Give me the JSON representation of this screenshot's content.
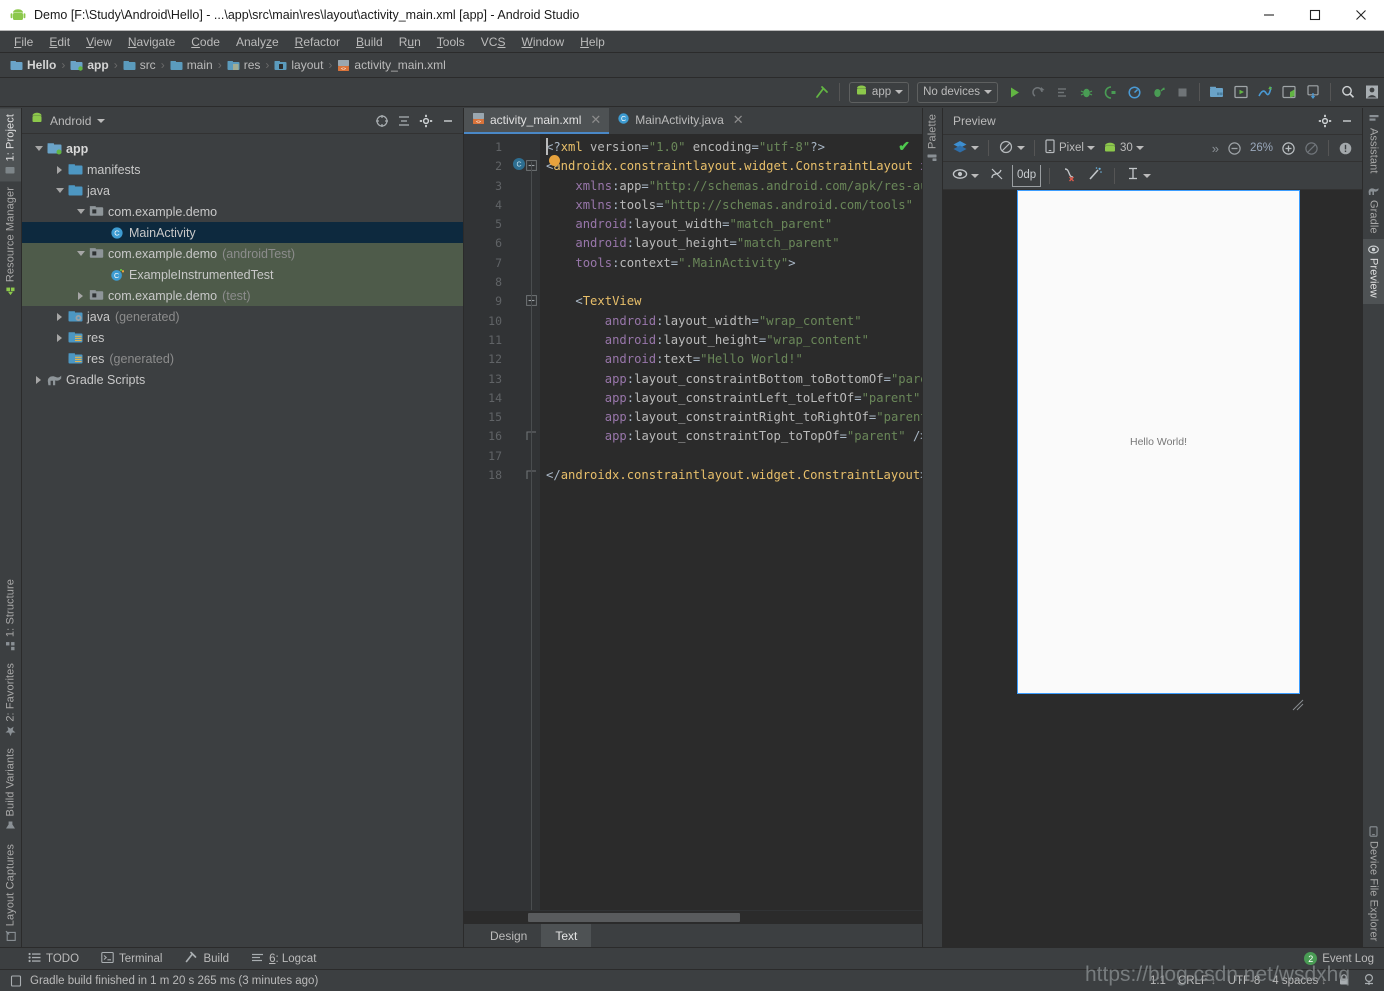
{
  "window": {
    "title": "Demo [F:\\Study\\Android\\Hello] - ...\\app\\src\\main\\res\\layout\\activity_main.xml [app] - Android Studio",
    "icon": "android-logo-icon",
    "minimize_label": "—",
    "maximize_label": "□",
    "close_label": "✕"
  },
  "menubar": {
    "items": [
      {
        "label": "File",
        "mnemonic": "F"
      },
      {
        "label": "Edit",
        "mnemonic": "E"
      },
      {
        "label": "View",
        "mnemonic": "V"
      },
      {
        "label": "Navigate",
        "mnemonic": "N"
      },
      {
        "label": "Code",
        "mnemonic": "C"
      },
      {
        "label": "Analyze",
        "mnemonic": "z"
      },
      {
        "label": "Refactor",
        "mnemonic": "R"
      },
      {
        "label": "Build",
        "mnemonic": "B"
      },
      {
        "label": "Run",
        "mnemonic": "u"
      },
      {
        "label": "Tools",
        "mnemonic": "T"
      },
      {
        "label": "VCS",
        "mnemonic": "S"
      },
      {
        "label": "Window",
        "mnemonic": "W"
      },
      {
        "label": "Help",
        "mnemonic": "H"
      }
    ]
  },
  "breadcrumb": {
    "items": [
      {
        "label": "Hello",
        "icon": "module-icon",
        "bold": true
      },
      {
        "label": "app",
        "icon": "module-app-icon",
        "bold": true
      },
      {
        "label": "src",
        "icon": "folder-icon",
        "bold": false
      },
      {
        "label": "main",
        "icon": "folder-icon",
        "bold": false
      },
      {
        "label": "res",
        "icon": "res-folder-icon",
        "bold": false
      },
      {
        "label": "layout",
        "icon": "layout-folder-icon",
        "bold": false
      },
      {
        "label": "activity_main.xml",
        "icon": "xml-layout-file-icon",
        "bold": false
      }
    ],
    "separator": "›"
  },
  "toolbar": {
    "build_hammer": "build-hammer-icon",
    "run_config": {
      "label": "app",
      "icon": "android-run-config-icon"
    },
    "device_selector": {
      "label": "No devices"
    },
    "buttons": [
      {
        "name": "run-button",
        "icon": "run-play-icon"
      },
      {
        "name": "apply-changes-button",
        "icon": "apply-changes-icon"
      },
      {
        "name": "apply-code-changes-button",
        "icon": "apply-code-changes-icon"
      },
      {
        "name": "debug-button",
        "icon": "debug-bug-icon"
      },
      {
        "name": "attach-debugger-button",
        "icon": "attach-debugger-icon"
      },
      {
        "name": "profiler-button",
        "icon": "profiler-icon"
      },
      {
        "name": "run-with-coverage-button",
        "icon": "run-coverage-icon"
      },
      {
        "name": "stop-button",
        "icon": "stop-square-icon"
      },
      {
        "name": "sdk-manager-button",
        "icon": "sdk-manager-icon"
      },
      {
        "name": "avd-manager-button",
        "icon": "avd-manager-icon"
      },
      {
        "name": "sync-gradle-button",
        "icon": "sync-gradle-icon"
      },
      {
        "name": "layout-inspector-button",
        "icon": "layout-inspector-icon"
      },
      {
        "name": "device-file-explorer-button",
        "icon": "device-download-icon"
      },
      {
        "name": "search-everywhere-button",
        "icon": "search-icon"
      },
      {
        "name": "user-account-button",
        "icon": "user-avatar-icon"
      }
    ]
  },
  "left_strip": {
    "top": [
      {
        "label": "1: Project",
        "mnemonic": "1",
        "icon": "project-icon",
        "active": true
      },
      {
        "label": "Resource Manager",
        "mnemonic": "",
        "icon": "resource-manager-icon",
        "active": false
      }
    ],
    "bottom": [
      {
        "label": "1: Structure",
        "mnemonic": "1",
        "icon": "structure-icon",
        "active": false
      },
      {
        "label": "2: Favorites",
        "mnemonic": "2",
        "icon": "favorites-star-icon",
        "active": false
      },
      {
        "label": "Build Variants",
        "mnemonic": "",
        "icon": "build-variants-icon",
        "active": false
      },
      {
        "label": "Layout Captures",
        "mnemonic": "",
        "icon": "layout-captures-icon",
        "active": false
      }
    ]
  },
  "right_strip": {
    "top": [
      {
        "label": "Assistant",
        "icon": "assistant-icon",
        "active": false
      },
      {
        "label": "Gradle",
        "icon": "gradle-elephant-icon",
        "active": false
      },
      {
        "label": "Preview",
        "icon": "preview-eye-icon",
        "active": true
      }
    ],
    "bottom": [
      {
        "label": "Device File Explorer",
        "icon": "device-file-explorer-icon",
        "active": false
      }
    ]
  },
  "editor_left_strip": {
    "items": [
      {
        "label": "Palette",
        "icon": "palette-icon",
        "active": false
      }
    ]
  },
  "project_panel": {
    "selector_label": "Android",
    "header_buttons": [
      {
        "name": "target-scope-button",
        "icon": "target-crosshair-icon"
      },
      {
        "name": "collapse-all-button",
        "icon": "collapse-all-icon"
      },
      {
        "name": "settings-gear-button",
        "icon": "gear-icon"
      },
      {
        "name": "hide-panel-button",
        "icon": "minus-icon"
      }
    ],
    "tree": [
      {
        "label": "app",
        "suffix": "",
        "indent": 0,
        "twisty": "down",
        "icon": "module-app-icon",
        "bold": true,
        "state": "normal"
      },
      {
        "label": "manifests",
        "suffix": "",
        "indent": 1,
        "twisty": "right",
        "icon": "folder-icon",
        "bold": false,
        "state": "normal"
      },
      {
        "label": "java",
        "suffix": "",
        "indent": 1,
        "twisty": "down",
        "icon": "folder-icon",
        "bold": false,
        "state": "normal"
      },
      {
        "label": "com.example.demo",
        "suffix": "",
        "indent": 2,
        "twisty": "down",
        "icon": "package-icon",
        "bold": false,
        "state": "normal"
      },
      {
        "label": "MainActivity",
        "suffix": "",
        "indent": 3,
        "twisty": "none",
        "icon": "java-class-icon",
        "bold": false,
        "state": "selected"
      },
      {
        "label": "com.example.demo",
        "suffix": "(androidTest)",
        "indent": 2,
        "twisty": "down",
        "icon": "package-icon",
        "bold": false,
        "state": "testgroup"
      },
      {
        "label": "ExampleInstrumentedTest",
        "suffix": "",
        "indent": 3,
        "twisty": "none",
        "icon": "java-test-class-icon",
        "bold": false,
        "state": "testgroup"
      },
      {
        "label": "com.example.demo",
        "suffix": "(test)",
        "indent": 2,
        "twisty": "right",
        "icon": "package-icon",
        "bold": false,
        "state": "testgroup"
      },
      {
        "label": "java",
        "suffix": "(generated)",
        "indent": 1,
        "twisty": "right",
        "icon": "generated-folder-icon",
        "bold": false,
        "state": "normal"
      },
      {
        "label": "res",
        "suffix": "",
        "indent": 1,
        "twisty": "right",
        "icon": "res-folder-icon",
        "bold": false,
        "state": "normal"
      },
      {
        "label": "res",
        "suffix": "(generated)",
        "indent": 1,
        "twisty": "none",
        "icon": "res-folder-icon",
        "bold": false,
        "state": "normal"
      },
      {
        "label": "Gradle Scripts",
        "suffix": "",
        "indent": 0,
        "twisty": "right",
        "icon": "gradle-elephant-icon",
        "bold": false,
        "state": "normal"
      }
    ]
  },
  "editor": {
    "tabs": [
      {
        "label": "activity_main.xml",
        "icon": "xml-layout-file-icon",
        "active": true,
        "close": "✕"
      },
      {
        "label": "MainActivity.java",
        "icon": "java-class-icon",
        "active": false,
        "close": "✕"
      }
    ],
    "inspection_status": "✔",
    "bottom_tabs": [
      {
        "label": "Design",
        "active": false
      },
      {
        "label": "Text",
        "active": true
      }
    ],
    "lines": [
      {
        "n": 1,
        "marker": "",
        "fold": "",
        "text": "<?xml version=\"1.0\" encoding=\"utf-8\"?>"
      },
      {
        "n": 2,
        "marker": "class-gutter-icon",
        "fold": "collapse",
        "text": "<androidx.constraintlayout.widget.ConstraintLayout xmlns:android=\"http://schemas.android.com/apk/res/android\""
      },
      {
        "n": 3,
        "marker": "",
        "fold": "",
        "text": "    xmlns:app=\"http://schemas.android.com/apk/res-auto\""
      },
      {
        "n": 4,
        "marker": "",
        "fold": "",
        "text": "    xmlns:tools=\"http://schemas.android.com/tools\""
      },
      {
        "n": 5,
        "marker": "",
        "fold": "",
        "text": "    android:layout_width=\"match_parent\""
      },
      {
        "n": 6,
        "marker": "",
        "fold": "",
        "text": "    android:layout_height=\"match_parent\""
      },
      {
        "n": 7,
        "marker": "",
        "fold": "",
        "text": "    tools:context=\".MainActivity\">"
      },
      {
        "n": 8,
        "marker": "",
        "fold": "",
        "text": ""
      },
      {
        "n": 9,
        "marker": "",
        "fold": "collapse",
        "text": "    <TextView"
      },
      {
        "n": 10,
        "marker": "",
        "fold": "",
        "text": "        android:layout_width=\"wrap_content\""
      },
      {
        "n": 11,
        "marker": "",
        "fold": "",
        "text": "        android:layout_height=\"wrap_content\""
      },
      {
        "n": 12,
        "marker": "",
        "fold": "",
        "text": "        android:text=\"Hello World!\""
      },
      {
        "n": 13,
        "marker": "",
        "fold": "",
        "text": "        app:layout_constraintBottom_toBottomOf=\"parent\""
      },
      {
        "n": 14,
        "marker": "",
        "fold": "",
        "text": "        app:layout_constraintLeft_toLeftOf=\"parent\""
      },
      {
        "n": 15,
        "marker": "",
        "fold": "",
        "text": "        app:layout_constraintRight_toRightOf=\"parent\""
      },
      {
        "n": 16,
        "marker": "",
        "fold": "end",
        "text": "        app:layout_constraintTop_toTopOf=\"parent\" />"
      },
      {
        "n": 17,
        "marker": "",
        "fold": "",
        "text": ""
      },
      {
        "n": 18,
        "marker": "",
        "fold": "end",
        "text": "</androidx.constraintlayout.widget.ConstraintLayout>"
      }
    ]
  },
  "preview": {
    "title": "Preview",
    "header_buttons": [
      {
        "name": "preview-settings-gear",
        "icon": "gear-icon"
      },
      {
        "name": "preview-hide-button",
        "icon": "minus-icon"
      }
    ],
    "toolbar_row1": {
      "design_mode": {
        "icon": "layers-icon",
        "label": ""
      },
      "orientation": {
        "icon": "orientation-icon",
        "label": ""
      },
      "device": {
        "icon": "phone-icon",
        "label": "Pixel"
      },
      "api_level": {
        "icon": "android-head-icon",
        "label": "30"
      },
      "overflow": "»",
      "zoom_out": "zoom-out-icon",
      "zoom_level": "26%",
      "zoom_in": "zoom-in-icon",
      "zoom_fit": "zoom-fit-icon",
      "issues": "issues-warning-icon"
    },
    "toolbar_row2": {
      "show_layout_decorations": {
        "icon": "eye-icon"
      },
      "turn_off_autoconnect": {
        "icon": "autoconnect-off-icon"
      },
      "default_margin": {
        "label": "0dp"
      },
      "clear_constraints": {
        "icon": "clear-constraints-icon"
      },
      "infer_constraints": {
        "icon": "magic-wand-icon"
      },
      "guidelines": {
        "icon": "guidelines-icon"
      }
    },
    "device_screen": {
      "text": "Hello World!"
    }
  },
  "bottom_bar": {
    "buttons": [
      {
        "label": "TODO",
        "mnemonic": "",
        "icon": "todo-icon"
      },
      {
        "label": "Terminal",
        "mnemonic": "",
        "icon": "terminal-icon"
      },
      {
        "label": "Build",
        "mnemonic": "",
        "icon": "build-hammer-icon"
      },
      {
        "label": "6: Logcat",
        "mnemonic": "6",
        "icon": "logcat-icon"
      }
    ],
    "event_log": {
      "label": "Event Log",
      "count": "2"
    }
  },
  "status_bar": {
    "icon": "status-doc-icon",
    "message": "Gradle build finished in 1 m 20 s 265 ms (3 minutes ago)",
    "caret_position": "1:1",
    "line_separator": "CRLF",
    "encoding": "UTF-8",
    "indent": "4 spaces",
    "lock_icon": "read-only-lock-icon",
    "inspector_icon": "hector-inspections-icon"
  },
  "watermark": {
    "text": "https://blog.csdn.net/wsdxhq"
  },
  "colors": {
    "accent_blue": "#4a88c7",
    "selection_blue": "#0d293e",
    "test_green": "#4e5b4a",
    "editor_bg": "#2b2b2b",
    "panel_bg": "#3c3f41",
    "device_border": "#3b9dff",
    "ok_green": "#4ec94e"
  }
}
